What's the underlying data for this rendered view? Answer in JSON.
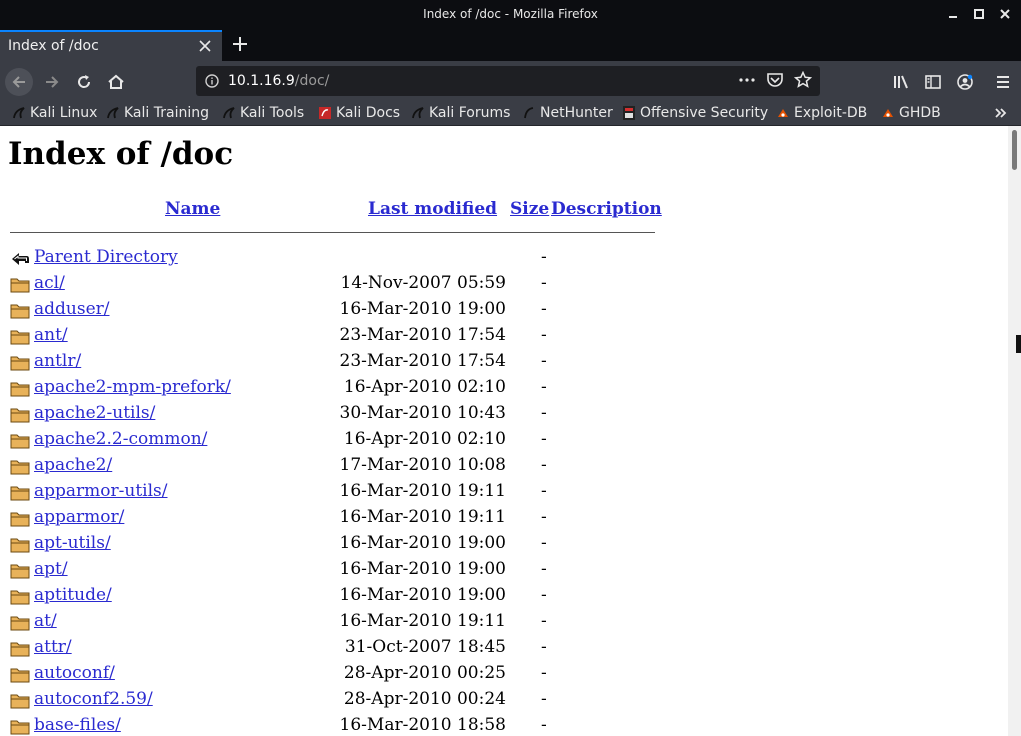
{
  "window": {
    "title": "Index of /doc - Mozilla Firefox"
  },
  "tab": {
    "title": "Index of /doc"
  },
  "urlbar": {
    "host": "10.1.16.9",
    "path": "/doc/"
  },
  "bookmarks": [
    {
      "label": "Kali Linux",
      "icon": "kali-dragon-icon"
    },
    {
      "label": "Kali Training",
      "icon": "kali-dragon-icon"
    },
    {
      "label": "Kali Tools",
      "icon": "kali-dragon-icon"
    },
    {
      "label": "Kali Docs",
      "icon": "kali-docs-icon"
    },
    {
      "label": "Kali Forums",
      "icon": "kali-dragon-icon"
    },
    {
      "label": "NetHunter",
      "icon": "nethunter-icon"
    },
    {
      "label": "Offensive Security",
      "icon": "offsec-icon"
    },
    {
      "label": "Exploit-DB",
      "icon": "exploitdb-icon"
    },
    {
      "label": "GHDB",
      "icon": "ghdb-icon"
    }
  ],
  "page": {
    "heading": "Index of /doc",
    "columns": {
      "name": "Name",
      "modified": "Last modified",
      "size": "Size",
      "description": "Description"
    },
    "parent": {
      "name": "Parent Directory",
      "size": "-"
    },
    "entries": [
      {
        "name": "acl/",
        "modified": "14-Nov-2007 05:59",
        "size": "-"
      },
      {
        "name": "adduser/",
        "modified": "16-Mar-2010 19:00",
        "size": "-"
      },
      {
        "name": "ant/",
        "modified": "23-Mar-2010 17:54",
        "size": "-"
      },
      {
        "name": "antlr/",
        "modified": "23-Mar-2010 17:54",
        "size": "-"
      },
      {
        "name": "apache2-mpm-prefork/",
        "modified": "16-Apr-2010 02:10",
        "size": "-"
      },
      {
        "name": "apache2-utils/",
        "modified": "30-Mar-2010 10:43",
        "size": "-"
      },
      {
        "name": "apache2.2-common/",
        "modified": "16-Apr-2010 02:10",
        "size": "-"
      },
      {
        "name": "apache2/",
        "modified": "17-Mar-2010 10:08",
        "size": "-"
      },
      {
        "name": "apparmor-utils/",
        "modified": "16-Mar-2010 19:11",
        "size": "-"
      },
      {
        "name": "apparmor/",
        "modified": "16-Mar-2010 19:11",
        "size": "-"
      },
      {
        "name": "apt-utils/",
        "modified": "16-Mar-2010 19:00",
        "size": "-"
      },
      {
        "name": "apt/",
        "modified": "16-Mar-2010 19:00",
        "size": "-"
      },
      {
        "name": "aptitude/",
        "modified": "16-Mar-2010 19:00",
        "size": "-"
      },
      {
        "name": "at/",
        "modified": "16-Mar-2010 19:11",
        "size": "-"
      },
      {
        "name": "attr/",
        "modified": "31-Oct-2007 18:45",
        "size": "-"
      },
      {
        "name": "autoconf/",
        "modified": "28-Apr-2010 00:25",
        "size": "-"
      },
      {
        "name": "autoconf2.59/",
        "modified": "28-Apr-2010 00:24",
        "size": "-"
      },
      {
        "name": "base-files/",
        "modified": "16-Mar-2010 18:58",
        "size": "-"
      }
    ]
  }
}
